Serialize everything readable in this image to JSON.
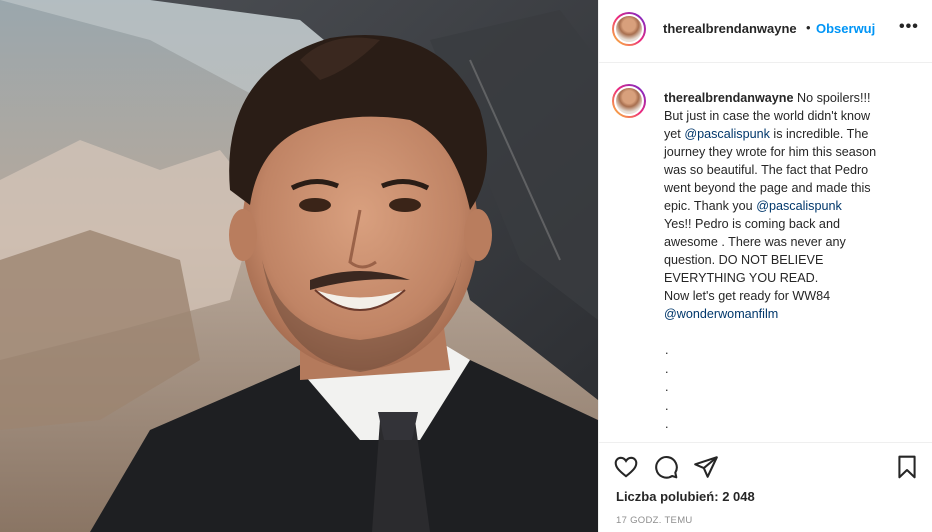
{
  "header": {
    "username": "therealbrendanwayne",
    "separator": "•",
    "follow_label": "Obserwuj",
    "more_label": "•••"
  },
  "caption": {
    "username": "therealbrendanwayne",
    "lines": [
      "No spoilers!!!",
      "But just in case the world didn't know",
      "yet",
      "@pascalispunk",
      "is incredible. The",
      "journey they wrote for him this season",
      "was so beautiful. The fact that Pedro",
      "went beyond the page and made this",
      "epic. Thank you",
      "@pascalispunk",
      "Yes!! Pedro is coming back and",
      "awesome . There was never any",
      "question. DO NOT BELIEVE",
      "EVERYTHING YOU READ.",
      "Now let's get ready for WW84",
      "@wonderwomanfilm"
    ],
    "dots": [
      ".",
      ".",
      ".",
      ".",
      "."
    ]
  },
  "actions": {
    "icons": [
      "heart-icon",
      "comment-icon",
      "share-icon",
      "bookmark-icon"
    ],
    "likes_label": "Liczba polubień:",
    "likes_count": "2 048",
    "timestamp": "17 godz. temu"
  },
  "colors": {
    "accent": "#0095f6",
    "mention": "#00376b",
    "text": "#262626",
    "muted": "#8e8e8e",
    "border": "#efefef"
  }
}
